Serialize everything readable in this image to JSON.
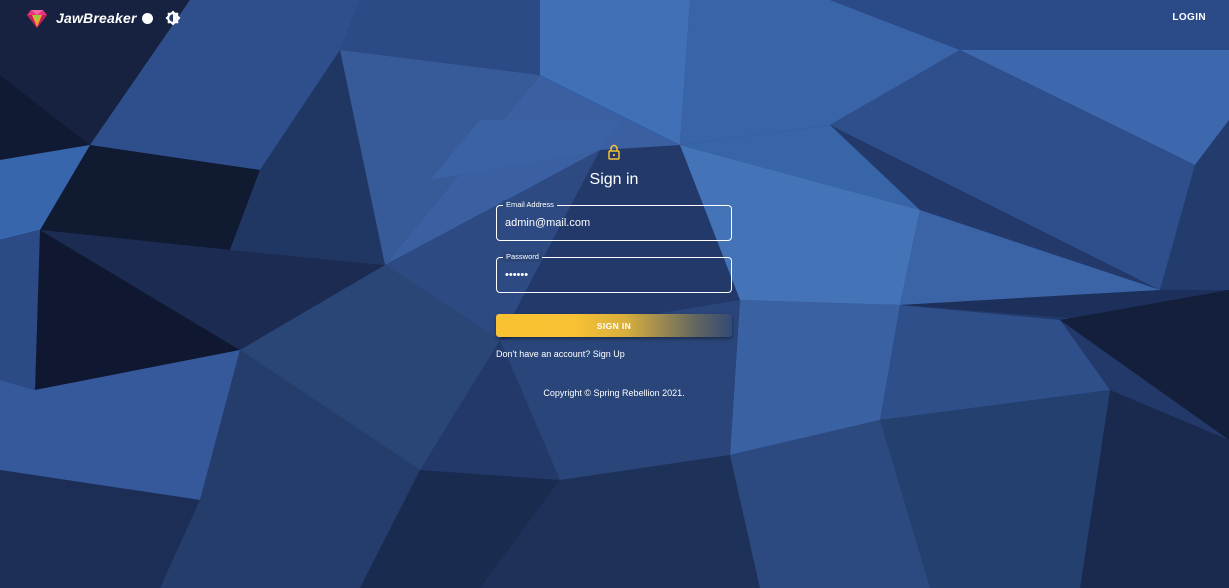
{
  "header": {
    "brand_name": "JawBreaker",
    "brand_logo_icon": "gem-icon",
    "theme_toggle_icon": "brightness-icon",
    "login_label": "LOGIN"
  },
  "signin": {
    "lock_icon": "lock-icon",
    "title": "Sign in",
    "email": {
      "label": "Email Address",
      "value": "admin@mail.com"
    },
    "password": {
      "label": "Password",
      "value": "••••••"
    },
    "submit_label": "SIGN IN",
    "signup_text": "Don't have an account? Sign Up"
  },
  "footer": {
    "copyright": "Copyright © Spring Rebellion 2021."
  },
  "colors": {
    "accent": "#f8c233",
    "background": "#1f3562",
    "logo": "#e8337a"
  }
}
